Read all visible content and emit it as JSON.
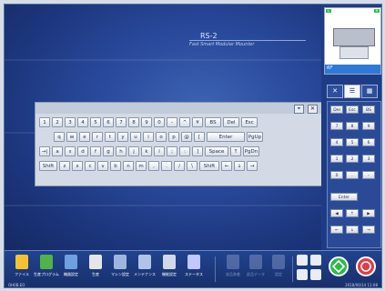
{
  "app": {
    "title": "RS-2",
    "subtitle": "Fast Smart Modular Mounter"
  },
  "preview": {
    "label": "RF",
    "corner_tl": "L",
    "corner_tr": "R"
  },
  "keyboard": {
    "pin_icon": "pin-icon",
    "close_symbol": "✕",
    "rows": [
      [
        "1",
        "2",
        "3",
        "4",
        "5",
        "6",
        "7",
        "8",
        "9",
        "0",
        "-",
        "^",
        "¥",
        "BS",
        "Del",
        "Esc"
      ],
      [
        "q",
        "w",
        "e",
        "r",
        "t",
        "y",
        "u",
        "i",
        "o",
        "p",
        "@",
        "[",
        "Enter",
        "PgUp"
      ],
      [
        "→|",
        "a",
        "s",
        "d",
        "f",
        "g",
        "h",
        "j",
        "k",
        "l",
        ";",
        ":",
        "]",
        "Space",
        "↑",
        "PgDn"
      ],
      [
        "Shift",
        "z",
        "x",
        "c",
        "v",
        "b",
        "n",
        "m",
        ",",
        ".",
        "/",
        "\\",
        "Shift",
        "←",
        "↓",
        "→"
      ]
    ]
  },
  "numpad": {
    "tabs": [
      "✕",
      "☰",
      "▦"
    ],
    "keys": [
      "Del",
      "Esc",
      "BS",
      "7",
      "8",
      "9",
      "4",
      "5",
      "6",
      "1",
      "2",
      "3",
      "0",
      ".",
      "-",
      "Enter",
      "◀",
      "↑",
      "▶",
      "←",
      "↓",
      "→"
    ]
  },
  "toolbar": {
    "items": [
      {
        "label": "ファイル",
        "icon": "folder-icon",
        "color": "#f2c230"
      },
      {
        "label": "生産プログラム",
        "icon": "program-icon",
        "color": "#4fb34a"
      },
      {
        "label": "機器設定",
        "icon": "machine-settings-icon",
        "color": "#6fa0e0"
      },
      {
        "label": "生産",
        "icon": "production-icon",
        "color": "#e6e6e6"
      },
      {
        "label": "マシン設定",
        "icon": "machine-icon",
        "color": "#9fb6dc"
      },
      {
        "label": "メンテナンス",
        "icon": "maintenance-icon",
        "color": "#b0c4e8"
      },
      {
        "label": "機能設定",
        "icon": "function-settings-icon",
        "color": "#d0d8ea"
      },
      {
        "label": "ステータス",
        "icon": "status-icon",
        "color": "#c0c8ff"
      }
    ],
    "disabled_items": [
      {
        "label": "部品装着",
        "icon": "parts-icon"
      },
      {
        "label": "部品データ",
        "icon": "part-data-icon"
      },
      {
        "label": "設定",
        "icon": "settings-icon"
      }
    ],
    "right_icons": [
      "label-icon",
      "tools-icon",
      "pen-icon",
      "copy-icon"
    ],
    "start_color": "#2fb84a",
    "stop_color": "#e23c45"
  },
  "status": {
    "left": "OH0B.EO",
    "right": "2018/06/14 11:08"
  }
}
